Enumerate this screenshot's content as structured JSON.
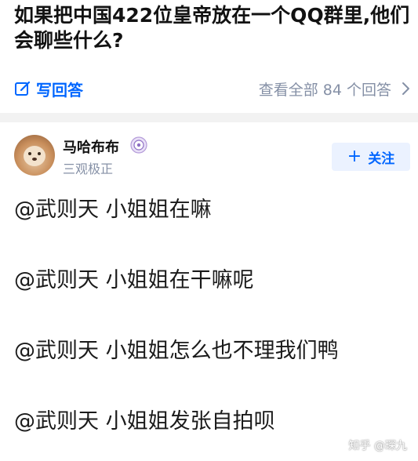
{
  "question": {
    "title": "如果把中国422位皇帝放在一个QQ群里,他们会聊些什么?"
  },
  "actions": {
    "write_answer": "写回答",
    "view_all": "查看全部 84 个回答"
  },
  "author": {
    "name": "马哈布布",
    "bio": "三观极正",
    "follow_label": "关注"
  },
  "answer": {
    "paragraphs": [
      "@武则天 小姐姐在嘛",
      "@武则天 小姐姐在干嘛呢",
      "@武则天 小姐姐怎么也不理我们鸭",
      "@武则天 小姐姐发张自拍呗"
    ]
  },
  "watermark": "知乎 @琛九",
  "colors": {
    "accent": "#0066ff",
    "muted": "#8590a6",
    "follow_bg": "#ebf2ff"
  },
  "icons": {
    "write": "edit-icon",
    "chevron": "chevron-right-icon",
    "badge": "verified-badge-icon"
  }
}
